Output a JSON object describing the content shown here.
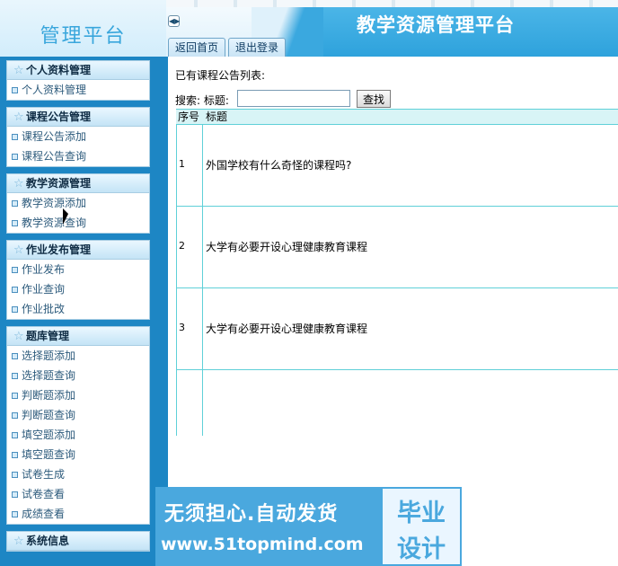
{
  "header": {
    "logo": "管理平台",
    "app_title": "教学资源管理平台",
    "toggle": "◀▶",
    "tabs": [
      "返回首页",
      "退出登录"
    ]
  },
  "sidebar": {
    "groups": [
      {
        "title": "个人资料管理",
        "items": [
          "个人资料管理"
        ]
      },
      {
        "title": "课程公告管理",
        "items": [
          "课程公告添加",
          "课程公告查询"
        ]
      },
      {
        "title": "教学资源管理",
        "items": [
          "教学资源添加",
          "教学资源查询"
        ]
      },
      {
        "title": "作业发布管理",
        "items": [
          "作业发布",
          "作业查询",
          "作业批改"
        ]
      },
      {
        "title": "题库管理",
        "items": [
          "选择题添加",
          "选择题查询",
          "判断题添加",
          "判断题查询",
          "填空题添加",
          "填空题查询",
          "试卷生成",
          "试卷查看",
          "成绩查看"
        ]
      },
      {
        "title": "系统信息",
        "items": []
      }
    ]
  },
  "main": {
    "section_title": "已有课程公告列表:",
    "search_label": "搜索: 标题:",
    "search_value": "",
    "search_button": "查找",
    "columns": [
      "序号",
      "标题"
    ],
    "rows": [
      {
        "no": "1",
        "title": "外国学校有什么奇怪的课程吗?"
      },
      {
        "no": "2",
        "title": "大学有必要开设心理健康教育课程"
      },
      {
        "no": "3",
        "title": "大学有必要开设心理健康教育课程"
      }
    ]
  },
  "watermark": {
    "line1": "无须担心.自动发货",
    "line2": "www.51topmind.com",
    "badge1": "毕业",
    "badge2": "设计"
  }
}
